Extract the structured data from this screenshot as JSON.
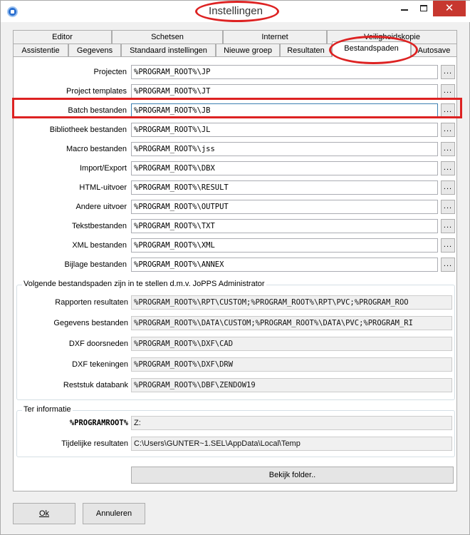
{
  "window": {
    "title": "Instellingen",
    "minimize_glyph": "",
    "close_glyph": "✕"
  },
  "tabs_row1": [
    "Editor",
    "Schetsen",
    "Internet",
    "Veiligheidskopie"
  ],
  "tabs_row2": [
    "Assistentie",
    "Gegevens",
    "Standaard instellingen",
    "Nieuwe groep",
    "Resultaten",
    "Bestandspaden",
    "Autosave"
  ],
  "active_tab": "Bestandspaden",
  "paths": [
    {
      "label": "Projecten",
      "value": "%PROGRAM_ROOT%\\JP"
    },
    {
      "label": "Project templates",
      "value": "%PROGRAM_ROOT%\\JT"
    },
    {
      "label": "Batch bestanden",
      "value": "%PROGRAM_ROOT%\\JB"
    },
    {
      "label": "Bibliotheek bestanden",
      "value": "%PROGRAM_ROOT%\\JL"
    },
    {
      "label": "Macro bestanden",
      "value": "%PROGRAM_ROOT%\\jss"
    },
    {
      "label": "Import/Export",
      "value": "%PROGRAM_ROOT%\\DBX"
    },
    {
      "label": "HTML-uitvoer",
      "value": "%PROGRAM_ROOT%\\RESULT"
    },
    {
      "label": "Andere uitvoer",
      "value": "%PROGRAM_ROOT%\\OUTPUT"
    },
    {
      "label": "Tekstbestanden",
      "value": "%PROGRAM_ROOT%\\TXT"
    },
    {
      "label": "XML bestanden",
      "value": "%PROGRAM_ROOT%\\XML"
    },
    {
      "label": "Bijlage bestanden",
      "value": "%PROGRAM_ROOT%\\ANNEX"
    }
  ],
  "browse_label": "...",
  "admin_group": {
    "title": "Volgende bestandspaden zijn in te stellen d.m.v. JoPPS Administrator",
    "rows": [
      {
        "label": "Rapporten resultaten",
        "value": "%PROGRAM_ROOT%\\RPT\\CUSTOM;%PROGRAM_ROOT%\\RPT\\PVC;%PROGRAM_ROO"
      },
      {
        "label": "Gegevens bestanden",
        "value": "%PROGRAM_ROOT%\\DATA\\CUSTOM;%PROGRAM_ROOT%\\DATA\\PVC;%PROGRAM_RI"
      },
      {
        "label": "DXF doorsneden",
        "value": "%PROGRAM_ROOT%\\DXF\\CAD"
      },
      {
        "label": "DXF tekeningen",
        "value": "%PROGRAM_ROOT%\\DXF\\DRW"
      },
      {
        "label": "Reststuk databank",
        "value": "%PROGRAM_ROOT%\\DBF\\ZENDOW19"
      }
    ]
  },
  "info_group": {
    "title": "Ter informatie",
    "rows": [
      {
        "label": "%PROGRAMROOT%",
        "value": "Z:"
      },
      {
        "label": "Tijdelijke resultaten",
        "value": "C:\\Users\\GUNTER~1.SEL\\AppData\\Local\\Temp"
      }
    ]
  },
  "view_folder_button": "Bekijk folder..",
  "ok_button": "Ok",
  "cancel_button": "Annuleren",
  "colors": {
    "annotation": "#dd2222",
    "focus_border": "#3c7fb1"
  }
}
